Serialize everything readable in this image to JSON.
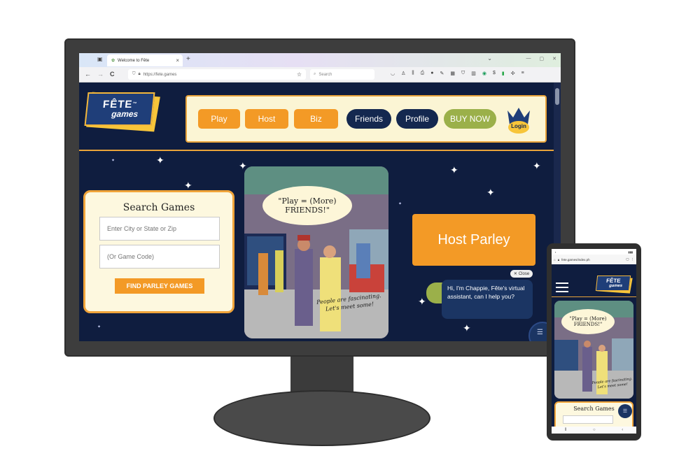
{
  "browser": {
    "tab_title": "Welcome to Fête",
    "tab_close": "×",
    "new_tab": "+",
    "url": "https://fete.games",
    "search_placeholder": "Search",
    "back": "←",
    "forward": "→",
    "reload": "C"
  },
  "site": {
    "logo_line1": "FÊTE",
    "logo_tm": "™",
    "logo_line2": "games",
    "menu": {
      "play": "Play",
      "host": "Host",
      "biz": "Biz",
      "friends": "Friends",
      "profile": "Profile",
      "buy_now": "BUY NOW",
      "login": "Login"
    },
    "search_card": {
      "title": "Search Games",
      "city_placeholder": "Enter City or State or Zip",
      "code_placeholder": "(Or Game Code)",
      "button": "FIND PARLEY GAMES"
    },
    "art": {
      "bubble_line1": "\"Play = (More)",
      "bubble_line2": "FRIENDS!\"",
      "caption_line1": "People are fascinating.",
      "caption_line2": "Let's meet some!"
    },
    "host_button": "Host Parley",
    "chat": {
      "close_label": "Close",
      "message": "Hi, I'm Chappie, Fête's virtual assistant, can I help you?"
    }
  },
  "phone": {
    "url": "fete.games/index.ph",
    "bubble_line1": "\"Play = (More)",
    "bubble_line2": "FRIENDS!\"",
    "caption_line1": "People are fascinating.",
    "caption_line2": "Let's meet some!",
    "search_title": "Search Games"
  },
  "colors": {
    "navy": "#0f1d3f",
    "orange": "#f39a26",
    "green": "#9bb04a",
    "cream": "#fbf5d4"
  }
}
